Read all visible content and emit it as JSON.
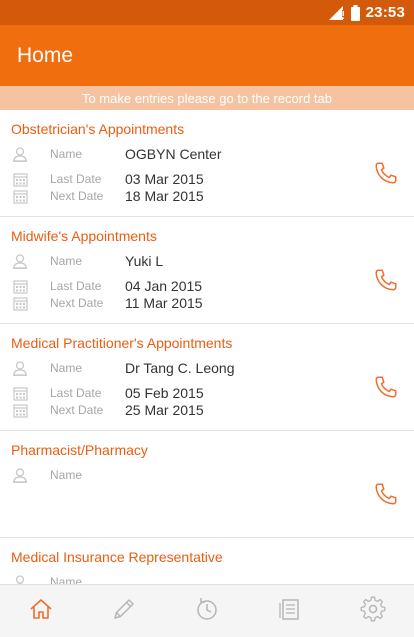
{
  "status_bar": {
    "time": "23:53",
    "icons": [
      "signal-icon",
      "battery-icon"
    ]
  },
  "app_bar": {
    "title": "Home"
  },
  "banner": {
    "text": "To make entries please go to the record tab"
  },
  "labels": {
    "name": "Name",
    "last_date": "Last Date",
    "next_date": "Next Date"
  },
  "sections": [
    {
      "title": "Obstetrician's Appointments",
      "name": "OGBYN Center",
      "last_date": "03 Mar 2015",
      "next_date": "18 Mar 2015"
    },
    {
      "title": "Midwife's Appointments",
      "name": "Yuki L",
      "last_date": "04 Jan 2015",
      "next_date": "11 Mar 2015"
    },
    {
      "title": "Medical Practitioner's Appointments",
      "name": "Dr Tang C. Leong",
      "last_date": "05 Feb 2015",
      "next_date": "25 Mar 2015"
    },
    {
      "title": "Pharmacist/Pharmacy",
      "name": "",
      "last_date": "",
      "next_date": ""
    },
    {
      "title": "Medical Insurance Representative",
      "name": "",
      "last_date": "",
      "next_date": ""
    }
  ],
  "bottom_nav": {
    "items": [
      "home-icon",
      "pencil-icon",
      "history-icon",
      "records-icon",
      "settings-icon"
    ],
    "active": "home-icon"
  },
  "colors": {
    "status_bar": "#d45a0b",
    "app_bar": "#f16e0f",
    "accent": "#ea5d12",
    "banner": "#f6c3a2",
    "icon_inactive": "#b5b5b5"
  }
}
